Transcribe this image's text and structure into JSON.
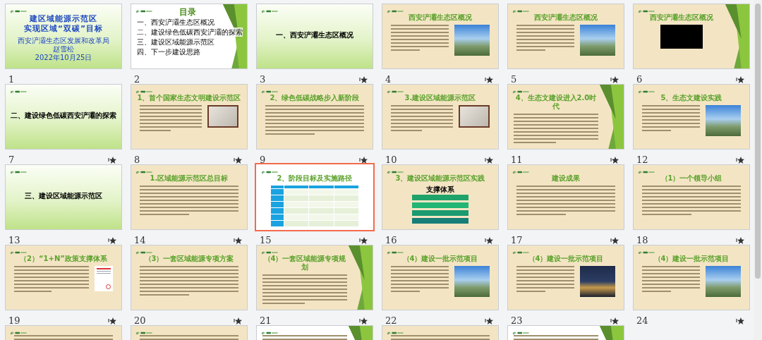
{
  "slides": [
    {
      "number": "1",
      "selected": false,
      "starred": false,
      "kind": "cover",
      "decor": false,
      "title_lines": [
        "建区域能源示范区",
        "实现区域“双碳”目标"
      ],
      "footer_lines": [
        "西安浐灞生态区发展和改革局",
        "赵雪松",
        "2022年10月25日"
      ]
    },
    {
      "number": "2",
      "selected": false,
      "starred": false,
      "kind": "toc",
      "decor": true,
      "title": "目录",
      "items": [
        "一、西安浐灞生态区概况",
        "二、建设绿色低碳西安浐灞的探索",
        "三、建设区域能源示范区",
        "四、下一步建设思路"
      ]
    },
    {
      "number": "3",
      "selected": false,
      "starred": true,
      "kind": "section",
      "decor": false,
      "title": "一、西安浐灞生态区概况"
    },
    {
      "number": "4",
      "selected": false,
      "starred": true,
      "kind": "beige-content",
      "decor": false,
      "title": "西安浐灞生态区概况",
      "picture": {
        "kind": "photo"
      }
    },
    {
      "number": "5",
      "selected": false,
      "starred": true,
      "kind": "beige-content",
      "decor": false,
      "title": "西安浐灞生态区概况",
      "picture": {
        "kind": "photo"
      }
    },
    {
      "number": "6",
      "selected": false,
      "starred": true,
      "kind": "beige-content",
      "decor": true,
      "title": "西安浐灞生态区概况",
      "picture": {
        "kind": "video"
      }
    },
    {
      "number": "7",
      "selected": false,
      "starred": true,
      "kind": "section",
      "decor": false,
      "title": "二、建设绿色低碳西安浐灞的探索"
    },
    {
      "number": "8",
      "selected": false,
      "starred": true,
      "kind": "beige-content",
      "decor": false,
      "title": "1、首个国家生态文明建设示范区",
      "picture": {
        "kind": "plaque"
      }
    },
    {
      "number": "9",
      "selected": false,
      "starred": true,
      "kind": "beige-content",
      "decor": false,
      "title": "2、绿色低碳战略步入新阶段"
    },
    {
      "number": "10",
      "selected": false,
      "starred": true,
      "kind": "beige-content",
      "decor": false,
      "title": "3.建设区域能源示范区",
      "picture": {
        "kind": "plaque"
      }
    },
    {
      "number": "11",
      "selected": false,
      "starred": true,
      "kind": "beige-content",
      "decor": true,
      "title": "4、生态文建设进入2.0时代"
    },
    {
      "number": "12",
      "selected": false,
      "starred": true,
      "kind": "beige-content",
      "decor": false,
      "title": "5、生态文建设实践",
      "picture": {
        "kind": "photo"
      }
    },
    {
      "number": "13",
      "selected": false,
      "starred": true,
      "kind": "section",
      "decor": false,
      "title": "三、建设区域能源示范区"
    },
    {
      "number": "14",
      "selected": false,
      "starred": true,
      "kind": "beige-content",
      "decor": false,
      "title": "1.区域能源示范区总目标"
    },
    {
      "number": "15",
      "selected": true,
      "starred": true,
      "kind": "white-content",
      "decor": false,
      "title": "2、阶段目标及实施路径",
      "picture": {
        "kind": "table"
      }
    },
    {
      "number": "16",
      "selected": false,
      "starred": true,
      "kind": "beige-content",
      "decor": false,
      "title": "3、建设区域能源示范区实践",
      "picture": {
        "kind": "flow",
        "caption": "支撑体系"
      }
    },
    {
      "number": "17",
      "selected": false,
      "starred": true,
      "kind": "beige-content",
      "decor": false,
      "title": "建设成果"
    },
    {
      "number": "18",
      "selected": false,
      "starred": true,
      "kind": "beige-content",
      "decor": false,
      "title": "（1）一个领导小组"
    },
    {
      "number": "19",
      "selected": false,
      "starred": true,
      "kind": "beige-content",
      "decor": false,
      "title": "（2）“1+N”政策支撑体系",
      "picture": {
        "kind": "document"
      }
    },
    {
      "number": "20",
      "selected": false,
      "starred": true,
      "kind": "beige-content",
      "decor": false,
      "title": "（3）一套区域能源专项方案"
    },
    {
      "number": "21",
      "selected": false,
      "starred": true,
      "kind": "beige-content",
      "decor": true,
      "title": "（4）一套区域能源专项规划"
    },
    {
      "number": "22",
      "selected": false,
      "starred": true,
      "kind": "beige-content",
      "decor": false,
      "title": "（4）建设一批示范项目",
      "picture": {
        "kind": "photo"
      }
    },
    {
      "number": "23",
      "selected": false,
      "starred": true,
      "kind": "beige-content",
      "decor": false,
      "title": "（4）建设一批示范项目",
      "picture": {
        "kind": "night-photo"
      }
    },
    {
      "number": "24",
      "selected": false,
      "starred": true,
      "kind": "beige-content",
      "decor": false,
      "title": "（4）建设一批示范项目",
      "picture": {
        "kind": "photo"
      }
    },
    {
      "selected": false,
      "kind": "beige-content",
      "decor": false
    },
    {
      "selected": false,
      "kind": "beige-content",
      "decor": false
    },
    {
      "selected": false,
      "kind": "white-content",
      "decor": true
    },
    {
      "selected": false,
      "kind": "beige-content",
      "decor": false
    },
    {
      "selected": false,
      "kind": "white-content",
      "decor": true
    }
  ]
}
